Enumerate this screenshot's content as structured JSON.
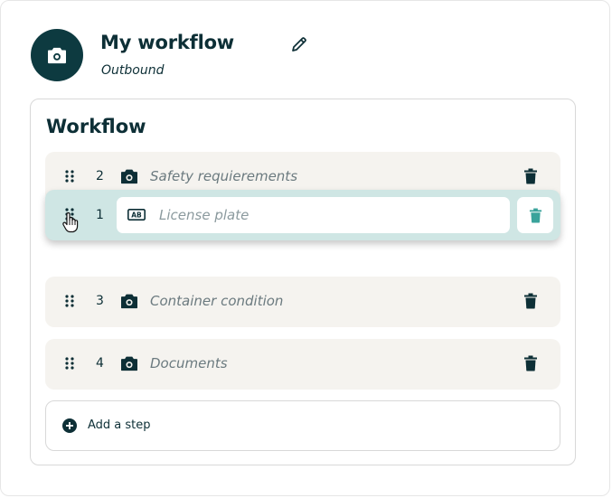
{
  "header": {
    "title": "My workflow",
    "subtitle": "Outbound",
    "avatar_icon": "camera-icon",
    "edit_icon": "pencil-icon"
  },
  "workflow": {
    "title": "Workflow",
    "dragging_step": {
      "number": "1",
      "icon": "text-field-icon",
      "icon_text": "AB",
      "placeholder": "License plate"
    },
    "steps": [
      {
        "number": "2",
        "icon": "camera-icon",
        "label": "Safety requierements"
      },
      {
        "number": "3",
        "icon": "camera-icon",
        "label": "Container condition"
      },
      {
        "number": "4",
        "icon": "camera-icon",
        "label": "Documents"
      }
    ],
    "add_step_label": "Add a step"
  },
  "colors": {
    "primary": "#0d3a40",
    "step_bg": "#f5f3ef",
    "drag_bg": "#cfe6e4",
    "accent_teal": "#3aa39b"
  }
}
